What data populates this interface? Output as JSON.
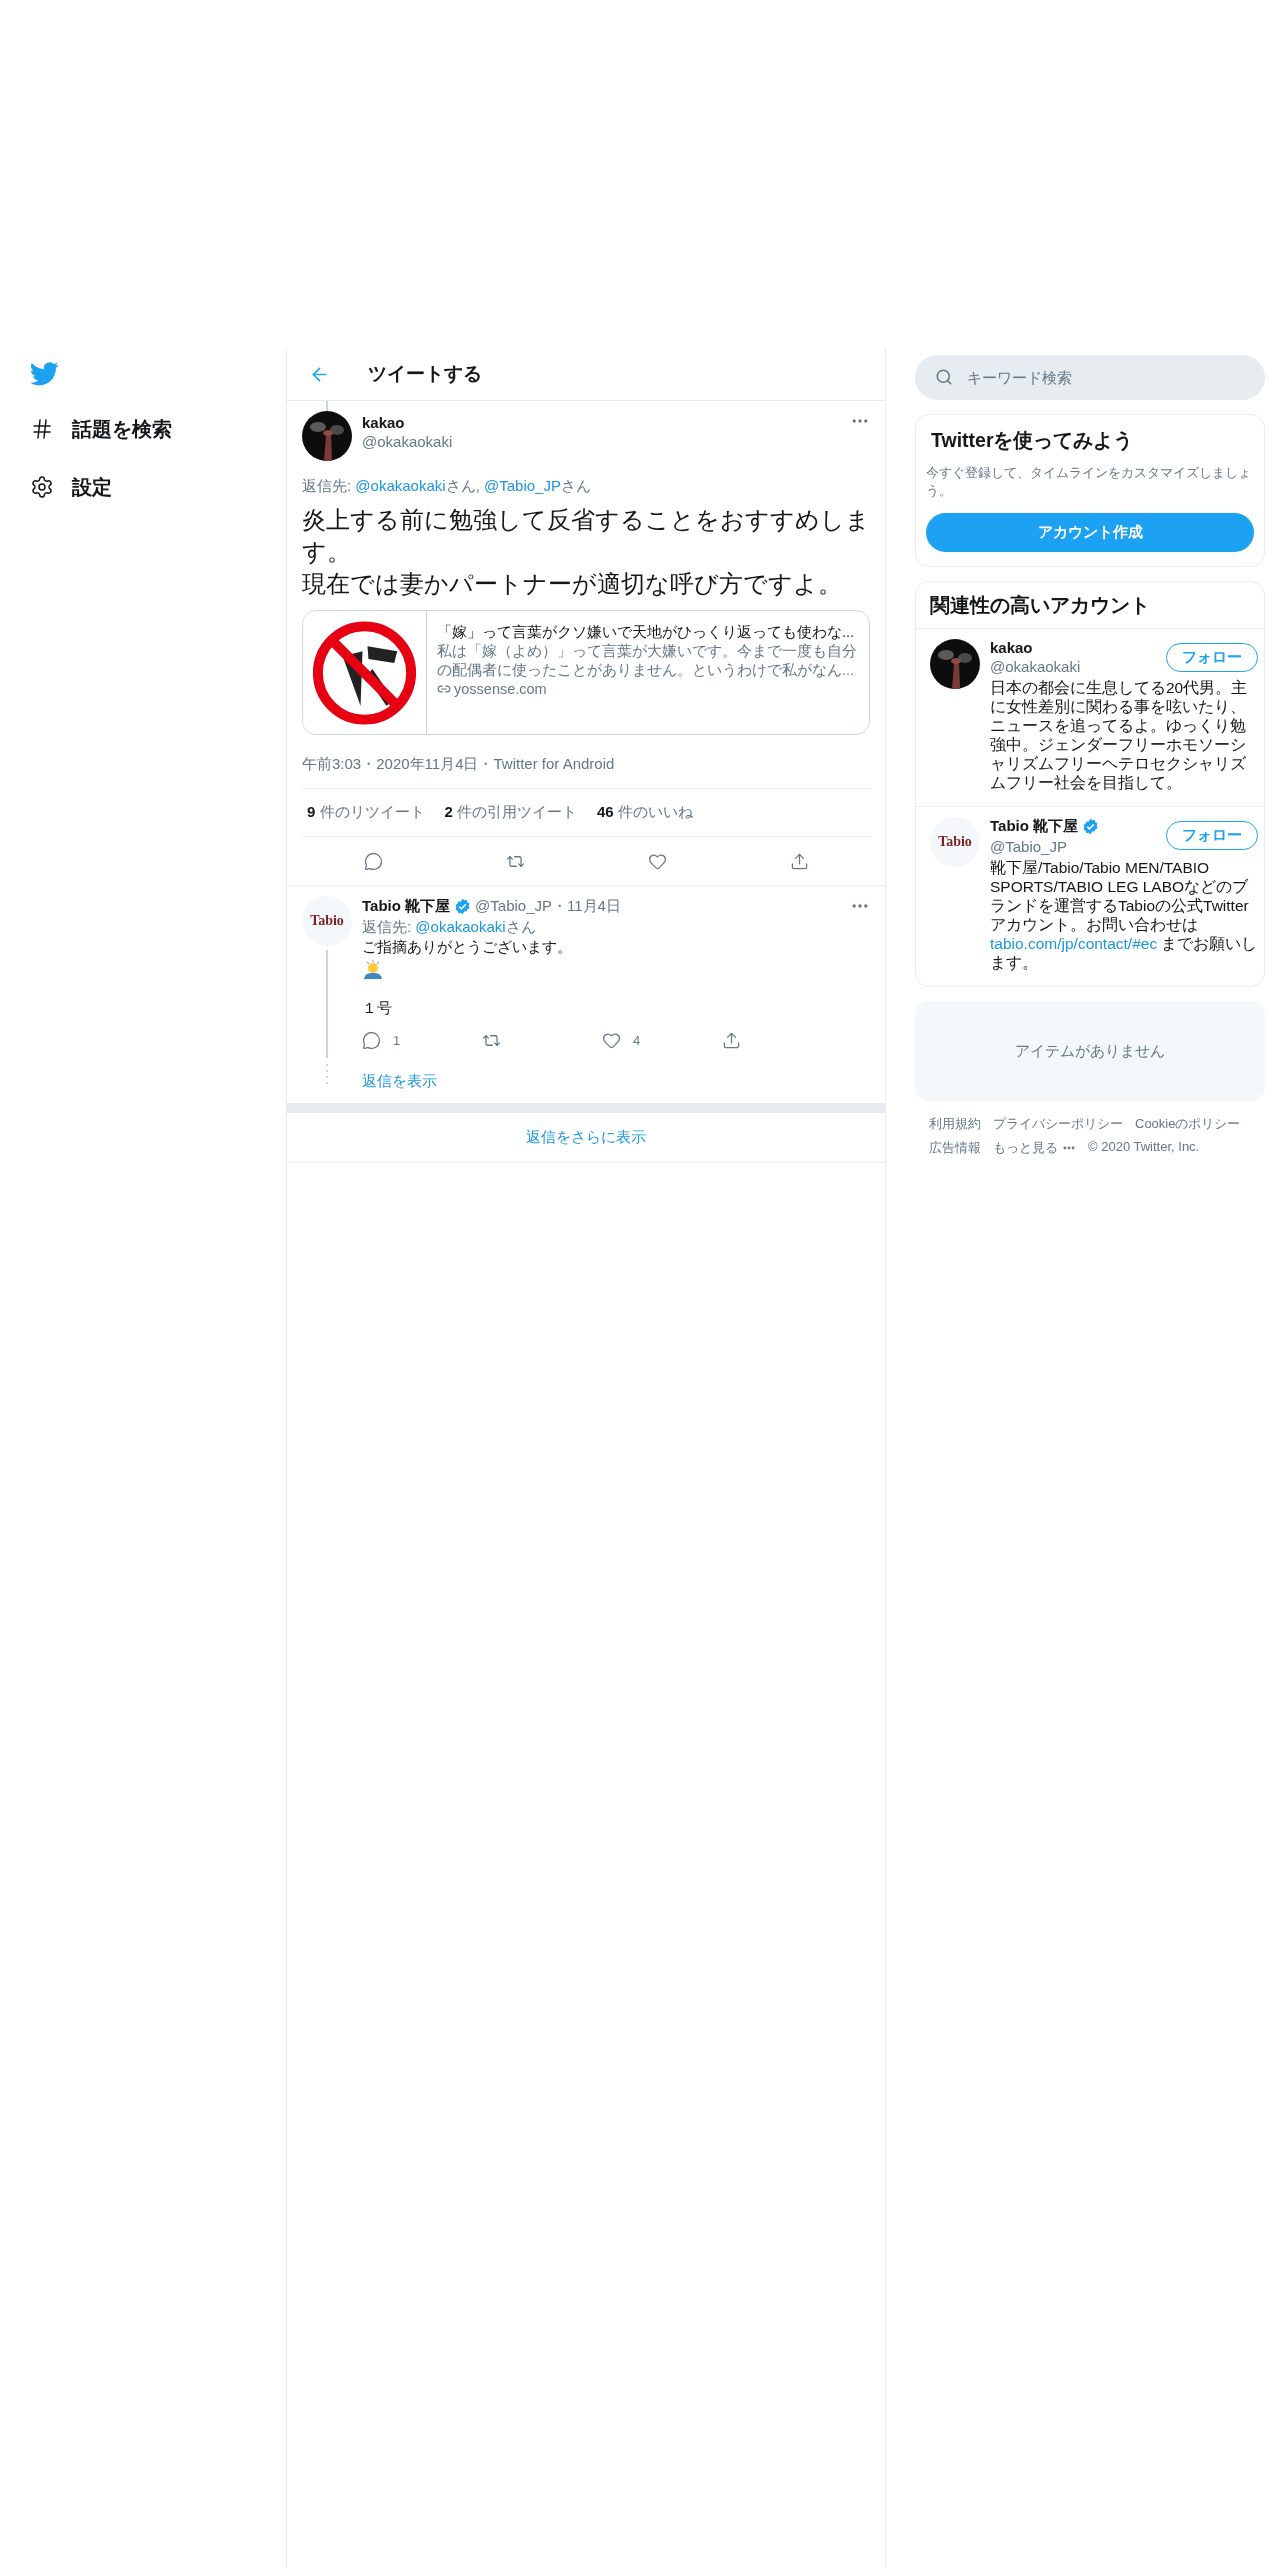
{
  "sidebar": {
    "items": [
      {
        "kind": "hashtag",
        "label": "話題を検索"
      },
      {
        "kind": "settings",
        "label": "設定"
      }
    ]
  },
  "header": {
    "title": "ツイートする"
  },
  "tweet": {
    "name": "kakao",
    "handle": "@okakaokaki",
    "reply_to": [
      {
        "text": "返信先: ",
        "link": false
      },
      {
        "text": "@okakaokaki",
        "link": true
      },
      {
        "text": "さん, ",
        "link": false
      },
      {
        "text": "@Tabio_JP",
        "link": true
      },
      {
        "text": "さん",
        "link": false
      }
    ],
    "body_lines": [
      "炎上する前に勉強して反省することをおすすめします。",
      "現在では妻かパートナーが適切な呼び方ですよ。"
    ],
    "card": {
      "title": "「嫁」って言葉がクソ嫌いで天地がひっくり返っても使わな...",
      "description": "私は「嫁（よめ）」って言葉が大嫌いです。今まで一度も自分の配偶者に使ったことがありません。というわけで私がなん...",
      "domain": "yossense.com"
    },
    "meta": "午前3:03・2020年11月4日・Twitter for Android",
    "stats": [
      {
        "count": "9",
        "label": "件のリツイート"
      },
      {
        "count": "2",
        "label": "件の引用ツイート"
      },
      {
        "count": "46",
        "label": "件のいいね"
      }
    ],
    "actions": [
      {
        "kind": "reply"
      },
      {
        "kind": "retweet"
      },
      {
        "kind": "like"
      },
      {
        "kind": "share"
      }
    ]
  },
  "reply": {
    "name": "Tabio 靴下屋",
    "verified": true,
    "meta": "@Tabio_JP・11月4日",
    "avatar_text": "Tabio",
    "reply_to": [
      {
        "text": "返信先: ",
        "link": false
      },
      {
        "text": "@okakaokaki",
        "link": true
      },
      {
        "text": "さん",
        "link": false
      }
    ],
    "body": [
      {
        "kind": "text",
        "text": "ご指摘ありがとうございます。"
      },
      {
        "kind": "emoji"
      },
      {
        "kind": "text",
        "text": "１号"
      }
    ],
    "actions": [
      {
        "kind": "reply",
        "count": "1"
      },
      {
        "kind": "retweet"
      },
      {
        "kind": "like",
        "count": "4"
      },
      {
        "kind": "share"
      }
    ],
    "show_replies": "返信を表示"
  },
  "more_replies": "返信をさらに表示",
  "search": {
    "placeholder": "キーワード検索"
  },
  "signup": {
    "title": "Twitterを使ってみよう",
    "text": "今すぐ登録して、タイムラインをカスタマイズしましょう。",
    "button": "アカウント作成"
  },
  "related": {
    "title": "関連性の高いアカウント",
    "accounts": [
      {
        "name": "kakao",
        "handle": "@okakaokaki",
        "verified": false,
        "avatar": {
          "kind": "picture"
        },
        "follow": "フォロー",
        "bio": [
          {
            "text": "日本の都会に生息してる20代男。主に女性差別に関わる事を呟いたり、ニュースを追ってるよ。ゆっくり勉強中。ジェンダーフリーホモソーシャリズムフリーヘテロセクシャリズムフリー社会を目指して。",
            "link": false
          }
        ]
      },
      {
        "name": "Tabio 靴下屋",
        "handle": "@Tabio_JP",
        "verified": true,
        "avatar": {
          "kind": "logo",
          "text": "Tabio"
        },
        "follow": "フォロー",
        "bio": [
          {
            "text": "靴下屋/Tabio/Tabio MEN/TABIO SPORTS/TABIO LEG LABOなどのブランドを運営するTabioの公式Twitterアカウント。お問い合わせは ",
            "link": false
          },
          {
            "text": "tabio.com/jp/contact/#ec",
            "link": true
          },
          {
            "text": " までお願いします。",
            "link": false
          }
        ]
      }
    ]
  },
  "empty": {
    "text": "アイテムがありません"
  },
  "footer": {
    "links": [
      "利用規約",
      "プライバシーポリシー",
      "Cookieのポリシー",
      "広告情報",
      "もっと見る"
    ],
    "copyright": "© 2020 Twitter, Inc."
  }
}
